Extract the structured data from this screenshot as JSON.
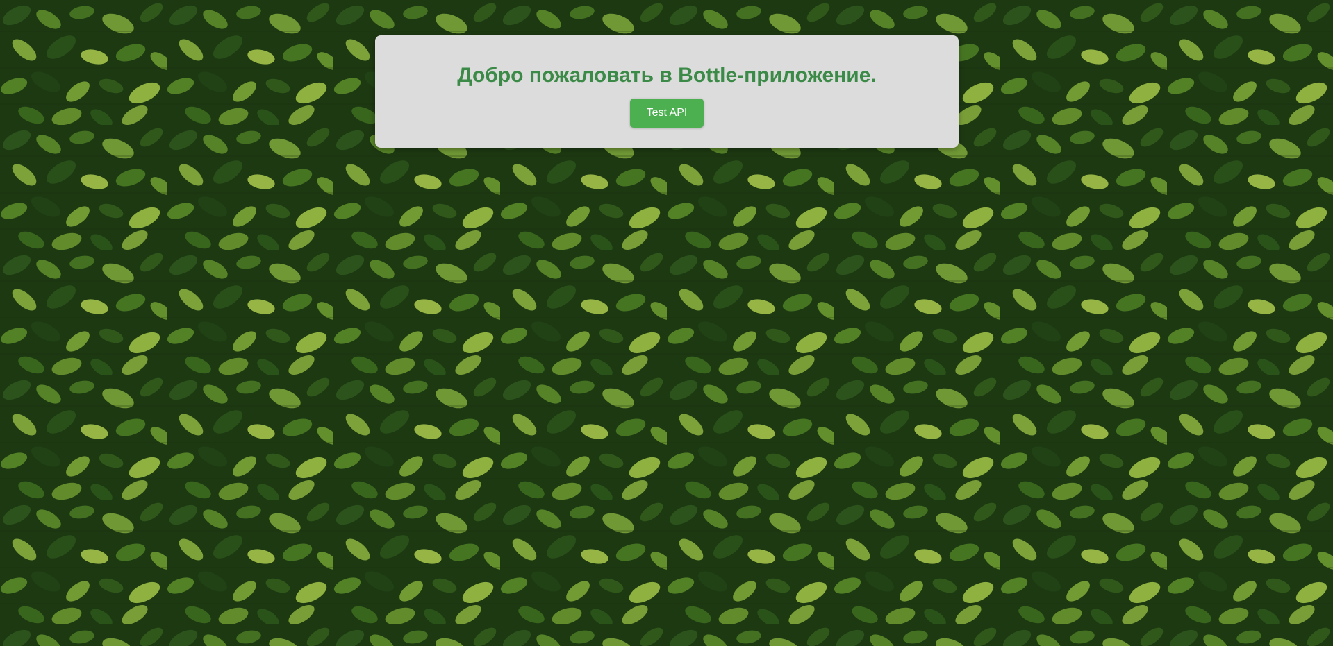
{
  "page": {
    "title": "Добро пожаловать в Bottle-приложение.",
    "button_label": "Test API",
    "background": {
      "description_icon": "leaf-pattern-background",
      "colors": {
        "dark": "#1f3b13",
        "mid": "#2f5a1d",
        "light": "#6f9b2f",
        "highlight": "#a8c64a"
      }
    },
    "colors": {
      "panel": "#dcdcdc",
      "title": "#3c8a47",
      "button": "#4caf50",
      "button_text": "#ffffff"
    }
  }
}
